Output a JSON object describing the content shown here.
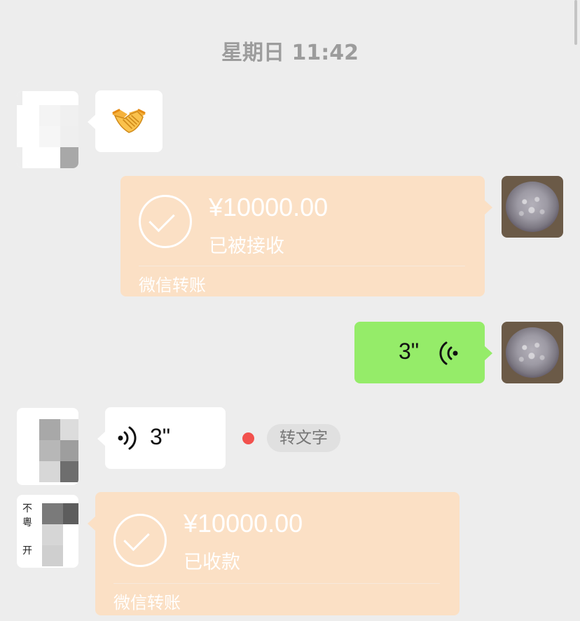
{
  "chat": {
    "timestamp": "星期日 11:42",
    "messages": [
      {
        "type": "emoji",
        "sender": "contact",
        "emoji": "handshake"
      },
      {
        "type": "transfer",
        "sender": "me",
        "amount": "¥10000.00",
        "status": "已被接收",
        "label": "微信转账"
      },
      {
        "type": "voice",
        "sender": "me",
        "duration": "3\""
      },
      {
        "type": "voice",
        "sender": "contact",
        "duration": "3\"",
        "unread": true,
        "to_text_label": "转文字"
      },
      {
        "type": "transfer",
        "sender": "contact",
        "amount": "¥10000.00",
        "status": "已收款",
        "label": "微信转账"
      }
    ]
  },
  "colors": {
    "background": "#ededed",
    "bubble_incoming": "#ffffff",
    "bubble_outgoing": "#95ec69",
    "transfer_card": "#fbe0c5",
    "unread_dot": "#f2514d",
    "timestamp_text": "#9c9c9c"
  },
  "icons": {
    "emoji": "handshake-emoji-icon",
    "transfer_done": "check-circle-icon",
    "voice": "voice-wave-icon"
  }
}
